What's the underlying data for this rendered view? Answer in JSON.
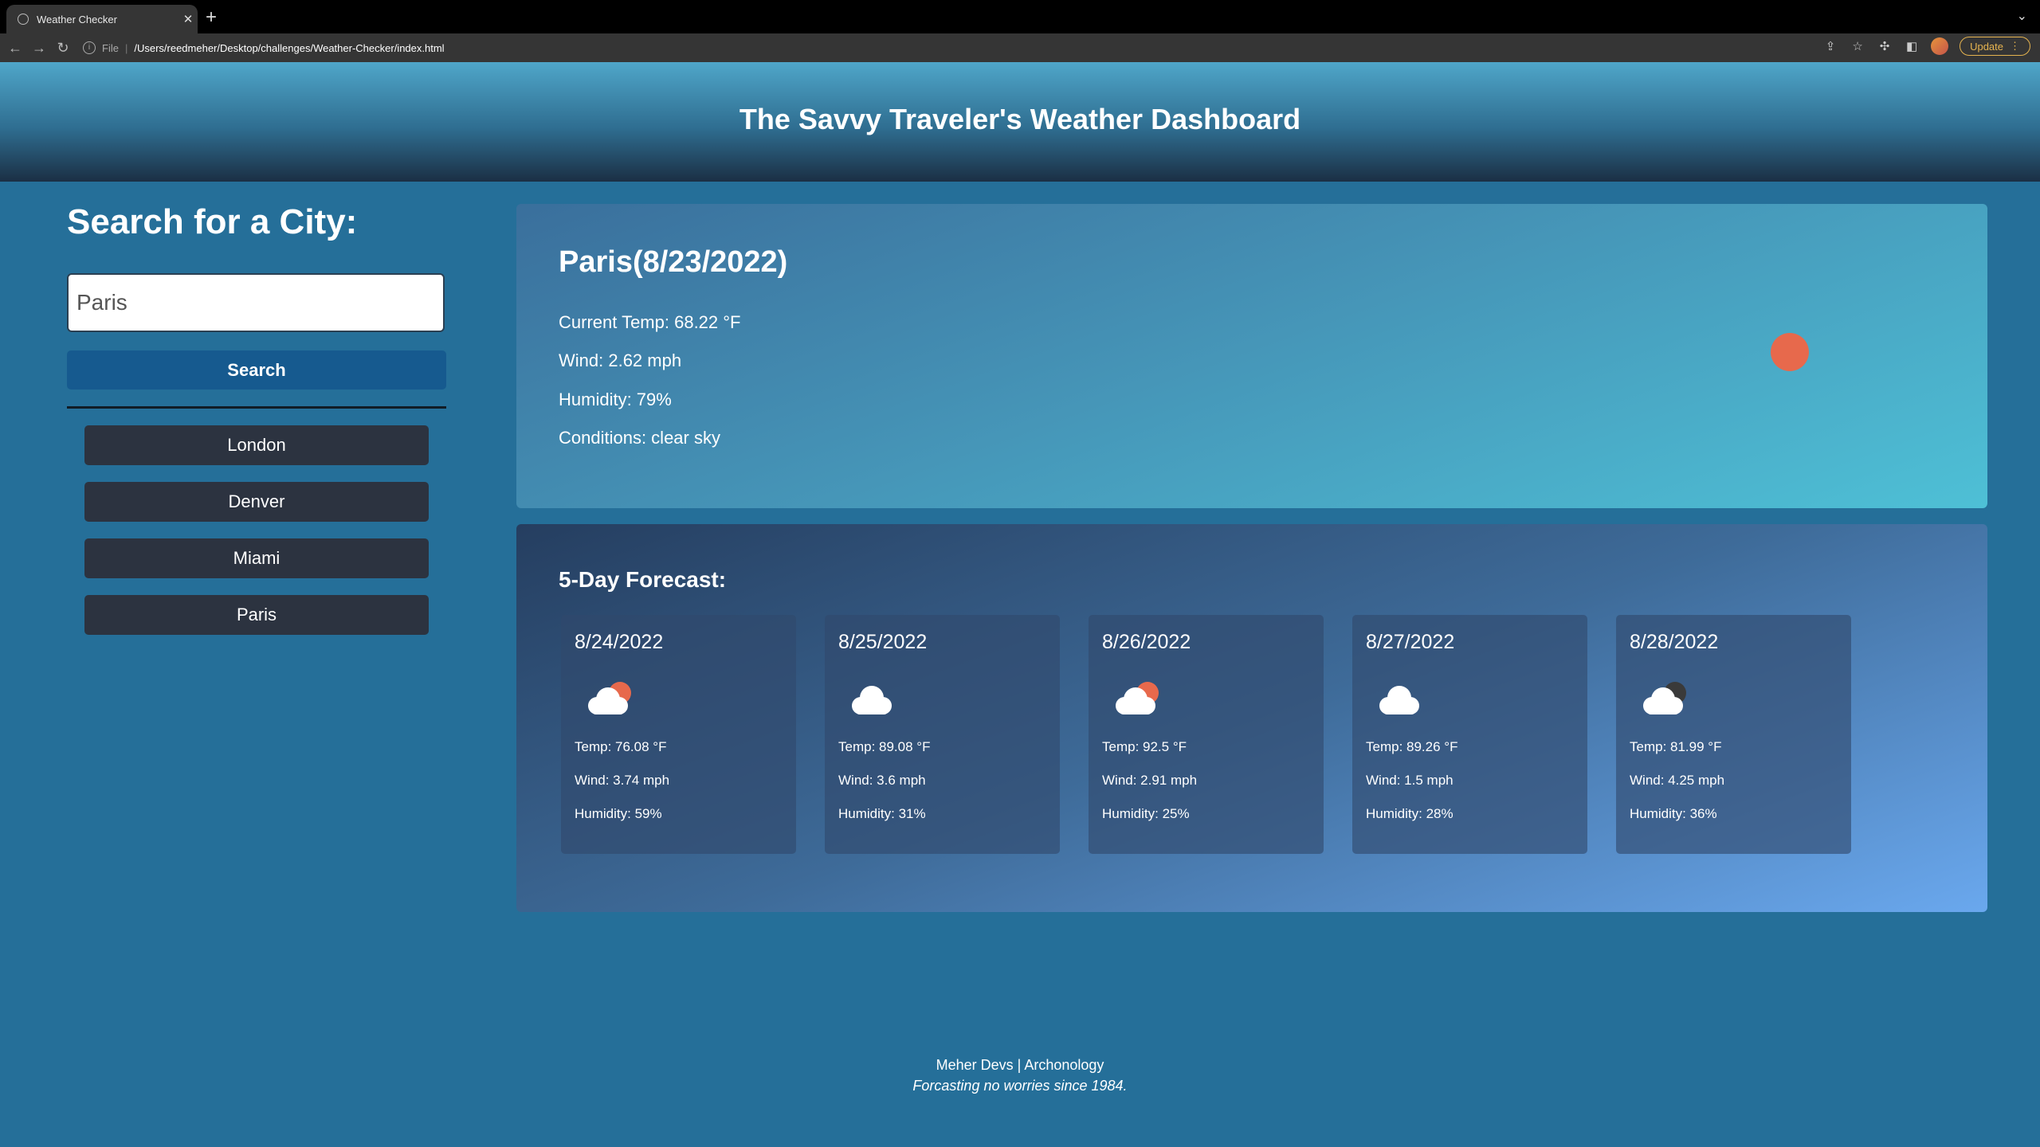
{
  "browser": {
    "tab_title": "Weather Checker",
    "tab_close": "✕",
    "new_tab": "+",
    "tab_menu": "⌄",
    "url_scheme": "File",
    "url_separator": "|",
    "url_path": "/Users/reedmeher/Desktop/challenges/Weather-Checker/index.html",
    "update_label": "Update",
    "icons": [
      "back-icon",
      "forward-icon",
      "reload-icon",
      "info-icon",
      "share-icon",
      "star-icon",
      "extensions-icon",
      "sidepanel-icon",
      "profile-icon",
      "kebab-menu-icon"
    ]
  },
  "header": {
    "title": "The Savvy Traveler's Weather Dashboard"
  },
  "search": {
    "heading": "Search for a City:",
    "input_value": "Paris",
    "button_label": "Search"
  },
  "history": [
    "London",
    "Denver",
    "Miami",
    "Paris"
  ],
  "current": {
    "city_date": "Paris(8/23/2022)",
    "temp": "Current Temp: 68.22 °F",
    "wind": "Wind: 2.62 mph",
    "humidity": "Humidity: 79%",
    "conditions": "Conditions: clear sky",
    "icon": "clear-sky-sun-icon",
    "sun_color": "#e7694c"
  },
  "forecast": {
    "heading": "5-Day Forecast:",
    "days": [
      {
        "date": "8/24/2022",
        "icon": "partly-cloudy-day-icon",
        "temp": "Temp: 76.08 °F",
        "wind": "Wind: 3.74 mph",
        "humidity": "Humidity: 59%"
      },
      {
        "date": "8/25/2022",
        "icon": "cloud-icon",
        "temp": "Temp: 89.08 °F",
        "wind": "Wind: 3.6 mph",
        "humidity": "Humidity: 31%"
      },
      {
        "date": "8/26/2022",
        "icon": "partly-cloudy-day-icon",
        "temp": "Temp: 92.5 °F",
        "wind": "Wind: 2.91 mph",
        "humidity": "Humidity: 25%"
      },
      {
        "date": "8/27/2022",
        "icon": "cloud-icon",
        "temp": "Temp: 89.26 °F",
        "wind": "Wind: 1.5 mph",
        "humidity": "Humidity: 28%"
      },
      {
        "date": "8/28/2022",
        "icon": "partly-cloudy-night-icon",
        "temp": "Temp: 81.99 °F",
        "wind": "Wind: 4.25 mph",
        "humidity": "Humidity: 36%"
      }
    ]
  },
  "footer": {
    "credit": "Meher Devs | Archonology",
    "tagline": "Forcasting no worries since 1984."
  },
  "colors": {
    "page_bg": "#256f99",
    "search_button": "#165a8f",
    "history_button": "#2c3340",
    "sun": "#e7694c",
    "moon": "#3a3a3a",
    "cloud": "#ffffff"
  }
}
